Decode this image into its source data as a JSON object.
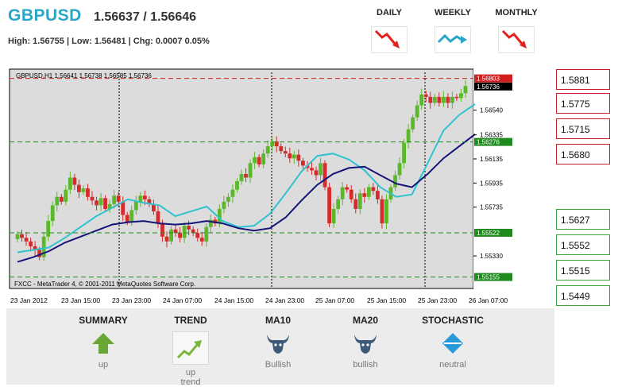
{
  "header": {
    "symbol": "GBPUSD",
    "quote": "1.56637 / 1.56646",
    "stats": "High: 1.56755 | Low: 1.56481 | Chg: 0.0007 0.05%"
  },
  "timeframes": [
    {
      "label": "DAILY",
      "icon": "down-trend-icon",
      "color": "#e0241b"
    },
    {
      "label": "WEEKLY",
      "icon": "sideways-trend-icon",
      "color": "#2aa6c9"
    },
    {
      "label": "MONTHLY",
      "icon": "down-trend-icon",
      "color": "#e0241b"
    }
  ],
  "chart": {
    "info": "GBPUSD,H1  1.56641 1.56738 1.56585 1.56736",
    "copyright": "FXCC - MetaTrader 4, © 2001-2011 MetaQuotes Software Corp.",
    "ylim": [
      1.5506,
      1.5688
    ],
    "y_ticks": [
      1.5654,
      1.56335,
      1.56135,
      1.55935,
      1.55735,
      1.5533
    ],
    "y_tick_labels": [
      "1.56540",
      "1.56335",
      "1.56135",
      "1.55935",
      "1.55735",
      "1.55330"
    ],
    "x_labels": [
      "23 Jan 2012",
      "23 Jan 15:00",
      "23 Jan 23:00",
      "24 Jan 07:00",
      "24 Jan 15:00",
      "24 Jan 23:00",
      "25 Jan 07:00",
      "25 Jan 15:00",
      "25 Jan 23:00",
      "26 Jan 07:00"
    ],
    "h_lines": [
      {
        "value": 1.56803,
        "label": "1.56803",
        "color": "#d21e1e",
        "style": "dashed"
      },
      {
        "value": 1.56736,
        "label": "1.56736",
        "color": "#000000",
        "style": "none"
      },
      {
        "value": 1.56276,
        "label": "1.56276",
        "color": "#1f8a1f",
        "style": "dashed"
      },
      {
        "value": 1.55522,
        "label": "1.55522",
        "color": "#1f8a1f",
        "style": "dashed"
      },
      {
        "value": 1.55155,
        "label": "1.55155",
        "color": "#1f8a1f",
        "style": "dashed"
      }
    ],
    "colors": {
      "bull": "#5cb82b",
      "bear": "#d52b2b",
      "ma_fast": "#2fc3cf",
      "ma_slow": "#14147a"
    }
  },
  "chart_data": {
    "type": "candlestick",
    "series": [
      {
        "name": "GBPUSD,H1",
        "closes": [
          1.5551,
          1.5548,
          1.5545,
          1.5541,
          1.5538,
          1.5532,
          1.5549,
          1.5562,
          1.5575,
          1.5582,
          1.5578,
          1.5588,
          1.5598,
          1.5592,
          1.5586,
          1.5589,
          1.5582,
          1.5579,
          1.5575,
          1.5581,
          1.5572,
          1.5576,
          1.5583,
          1.5578,
          1.5567,
          1.5561,
          1.5571,
          1.5578,
          1.5583,
          1.558,
          1.5576,
          1.557,
          1.556,
          1.5549,
          1.5545,
          1.5555,
          1.5552,
          1.5548,
          1.5558,
          1.5555,
          1.5552,
          1.5548,
          1.5545,
          1.5557,
          1.5563,
          1.556,
          1.5572,
          1.5578,
          1.5582,
          1.5588,
          1.5595,
          1.5601,
          1.5598,
          1.561,
          1.5615,
          1.5609,
          1.5618,
          1.5624,
          1.5628,
          1.5624,
          1.562,
          1.5618,
          1.5614,
          1.5617,
          1.5612,
          1.5608,
          1.5606,
          1.5604,
          1.56,
          1.561,
          1.559,
          1.556,
          1.5572,
          1.558,
          1.559,
          1.5588,
          1.558,
          1.5572,
          1.5585,
          1.5582,
          1.559,
          1.5587,
          1.558,
          1.556,
          1.558,
          1.559,
          1.56,
          1.561,
          1.5627,
          1.5638,
          1.5648,
          1.5658,
          1.5667,
          1.5665,
          1.566,
          1.5665,
          1.566,
          1.5665,
          1.566,
          1.5665,
          1.5664,
          1.5668,
          1.5674
        ]
      },
      {
        "name": "MA fast",
        "values": [
          1.5536,
          1.5538,
          1.554,
          1.5548,
          1.5557,
          1.5566,
          1.5573,
          1.558,
          1.5577,
          1.5575,
          1.5566,
          1.557,
          1.5574,
          1.5562,
          1.5557,
          1.5558,
          1.5568,
          1.5585,
          1.5603,
          1.5616,
          1.5618,
          1.5613,
          1.5604,
          1.559,
          1.5582,
          1.5584,
          1.561,
          1.5637,
          1.565,
          1.5659
        ]
      },
      {
        "name": "MA slow",
        "values": [
          1.5528,
          1.5532,
          1.5537,
          1.5544,
          1.5549,
          1.5554,
          1.5559,
          1.5561,
          1.5562,
          1.556,
          1.5559,
          1.556,
          1.5562,
          1.556,
          1.5556,
          1.5554,
          1.5556,
          1.5565,
          1.5579,
          1.5592,
          1.5601,
          1.5606,
          1.5607,
          1.56,
          1.5593,
          1.559,
          1.5601,
          1.5614,
          1.5624,
          1.5634
        ]
      }
    ],
    "ylim": [
      1.5506,
      1.5688
    ]
  },
  "levels": {
    "resistance": [
      "1.5881",
      "1.5775",
      "1.5715",
      "1.5680"
    ],
    "support": [
      "1.5627",
      "1.5552",
      "1.5515",
      "1.5449"
    ],
    "colors": {
      "resistance": "#c81e28",
      "support": "#3aa53a"
    }
  },
  "indicators": [
    {
      "title": "SUMMARY",
      "value": "up",
      "icon": "arrow-up-icon",
      "color": "#6aa635"
    },
    {
      "title": "TREND",
      "value": "up\ntrend",
      "icon": "trend-up-chart-icon",
      "color": "#7bb83a"
    },
    {
      "title": "MA10",
      "value": "Bullish",
      "icon": "bull-icon",
      "color": "#3d5a78"
    },
    {
      "title": "MA20",
      "value": "bullish",
      "icon": "bull-icon",
      "color": "#3d5a78"
    },
    {
      "title": "STOCHASTIC",
      "value": "neutral",
      "icon": "neutral-diamond-icon",
      "color": "#2b9ad8"
    }
  ]
}
